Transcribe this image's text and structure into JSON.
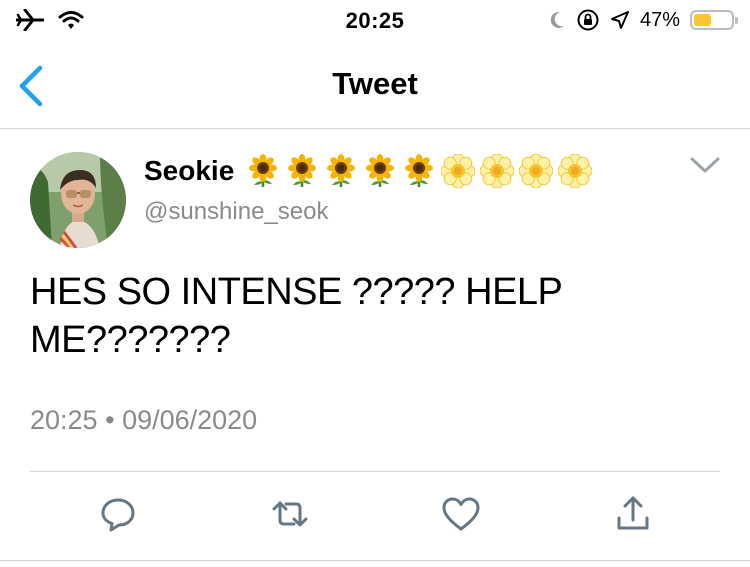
{
  "status_bar": {
    "time": "20:25",
    "battery_percent": "47%",
    "battery_level": 0.47,
    "icons": [
      "airplane-icon",
      "wifi-icon",
      "moon-icon",
      "orientation-lock-icon",
      "location-icon",
      "battery-icon"
    ]
  },
  "nav": {
    "title": "Tweet",
    "back_icon": "chevron-left-icon",
    "accent_color": "#1da1f2"
  },
  "tweet": {
    "author_name": "Seokie",
    "author_emojis": [
      "sunflower",
      "sunflower",
      "sunflower",
      "sunflower",
      "sunflower",
      "blossom",
      "blossom",
      "blossom",
      "blossom"
    ],
    "handle": "@sunshine_seok",
    "text": "HES SO INTENSE ????? HELP ME???????",
    "time": "20:25",
    "separator": "•",
    "date": "09/06/2020"
  },
  "actions": [
    "reply-icon",
    "retweet-icon",
    "like-icon",
    "share-icon"
  ],
  "colors": {
    "icon_gray": "#657786",
    "meta_gray": "#8a8a8a",
    "divider": "#d4d4d4"
  }
}
